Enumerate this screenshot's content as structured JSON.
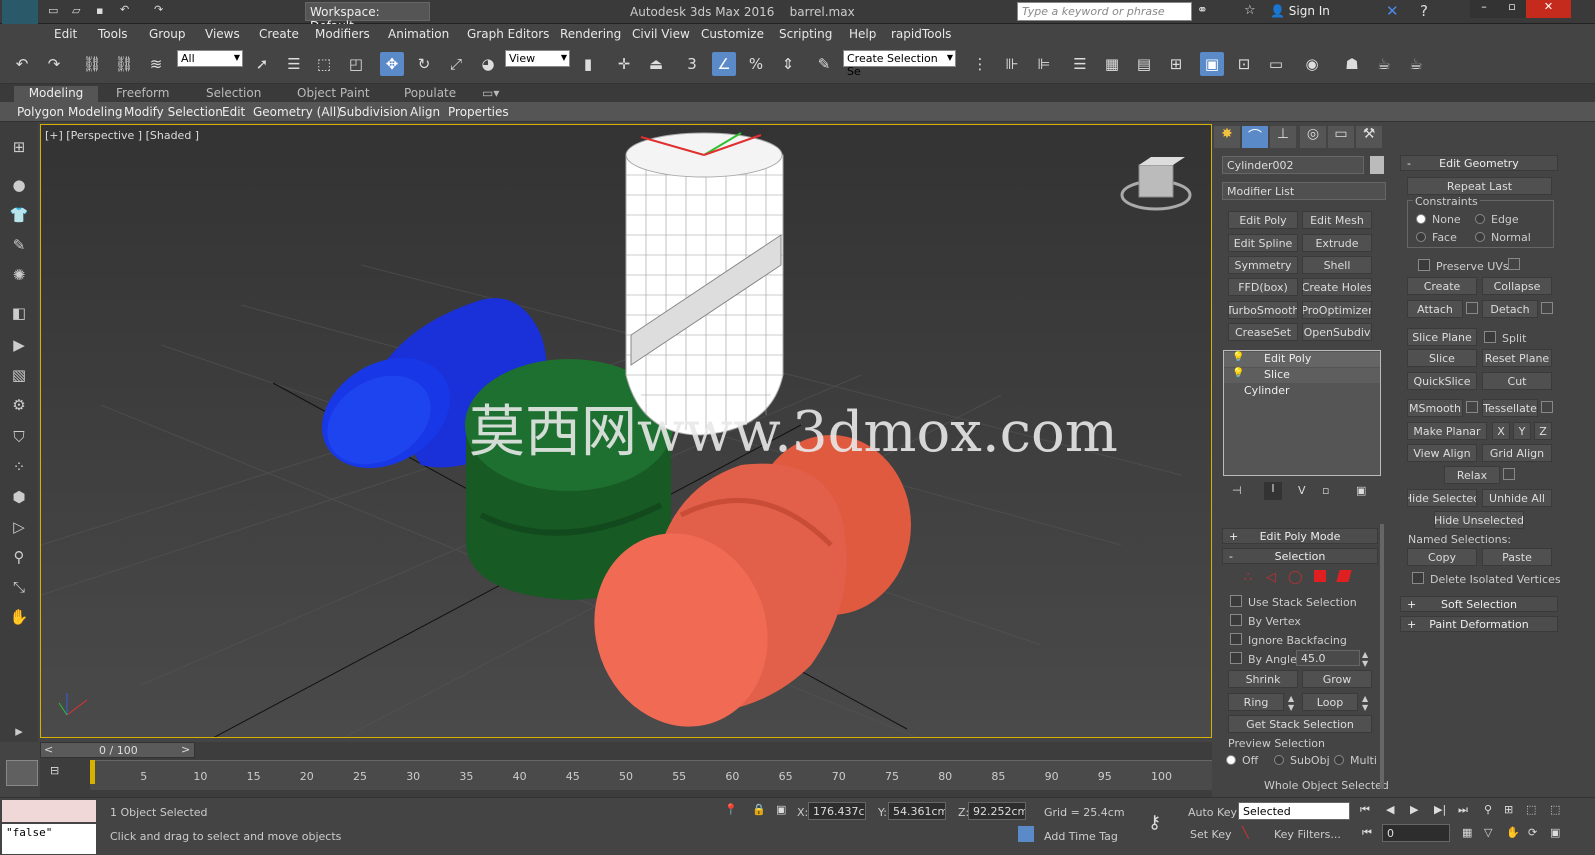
{
  "titlebar": {
    "app_icon": "MAX",
    "workspace": "Workspace: Default",
    "title": "Autodesk 3ds Max 2016",
    "filename": "barrel.max",
    "search_placeholder": "Type a keyword or phrase",
    "sign_in": "Sign In"
  },
  "menubar": [
    "Edit",
    "Tools",
    "Group",
    "Views",
    "Create",
    "Modifiers",
    "Animation",
    "Graph Editors",
    "Rendering",
    "Civil View",
    "Customize",
    "Scripting",
    "Help",
    "rapidTools"
  ],
  "toolbar": {
    "filter": "All",
    "coord_system": "View",
    "selection_set": "Create Selection Se"
  },
  "ribbon_tabs": [
    "Modeling",
    "Freeform",
    "Selection",
    "Object Paint",
    "Populate"
  ],
  "ribbon_sub": [
    "Polygon Modeling",
    "Modify Selection",
    "Edit",
    "Geometry (All)",
    "Subdivision",
    "Align",
    "Properties"
  ],
  "viewport": {
    "label": "[+] [Perspective ] [Shaded ]",
    "watermark": "莫西网www.3dmox.com",
    "colors": {
      "blue": "#1a3de0",
      "green": "#1e6a2c",
      "salmon": "#e86048",
      "wire": "#e0e0e0"
    }
  },
  "command_panel": {
    "object_name": "Cylinder002",
    "modifier_list": "Modifier List",
    "modifier_buttons": [
      "Edit Poly",
      "Edit Mesh",
      "Edit Spline",
      "Extrude",
      "Symmetry",
      "Shell",
      "FFD(box)",
      "Create Holes",
      "TurboSmooth",
      "ProOptimizer",
      "CreaseSet",
      "OpenSubdiv"
    ],
    "stack": [
      "Edit Poly",
      "Slice",
      "Cylinder"
    ],
    "edit_poly_mode": "Edit Poly Mode",
    "selection": "Selection",
    "use_stack_selection": "Use Stack Selection",
    "by_vertex": "By Vertex",
    "ignore_backfacing": "Ignore Backfacing",
    "by_angle": "By Angle:",
    "angle_value": "45.0",
    "shrink": "Shrink",
    "grow": "Grow",
    "ring": "Ring",
    "loop": "Loop",
    "get_stack_selection": "Get Stack Selection",
    "preview_selection": "Preview Selection",
    "preview_off": "Off",
    "preview_subobj": "SubObj",
    "preview_multi": "Multi",
    "whole_object": "Whole Object Selected"
  },
  "edit_geometry": {
    "header": "Edit Geometry",
    "repeat_last": "Repeat Last",
    "constraints": "Constraints",
    "none": "None",
    "edge": "Edge",
    "face": "Face",
    "normal": "Normal",
    "preserve_uvs": "Preserve UVs",
    "create": "Create",
    "collapse": "Collapse",
    "attach": "Attach",
    "detach": "Detach",
    "slice_plane": "Slice Plane",
    "split": "Split",
    "slice": "Slice",
    "reset_plane": "Reset Plane",
    "quickslice": "QuickSlice",
    "cut": "Cut",
    "msmooth": "MSmooth",
    "tessellate": "Tessellate",
    "make_planar": "Make Planar",
    "x": "X",
    "y": "Y",
    "z": "Z",
    "view_align": "View Align",
    "grid_align": "Grid Align",
    "relax": "Relax",
    "hide_selected": "Hide Selected",
    "unhide_all": "Unhide All",
    "hide_unselected": "Hide Unselected",
    "named_selections": "Named Selections:",
    "copy": "Copy",
    "paste": "Paste",
    "delete_isolated": "Delete Isolated Vertices",
    "soft_selection": "Soft Selection",
    "paint_deformation": "Paint Deformation"
  },
  "timeline": {
    "frame": "0 / 100",
    "ticks": [
      "5",
      "10",
      "15",
      "20",
      "25",
      "30",
      "35",
      "40",
      "45",
      "50",
      "55",
      "60",
      "65",
      "70",
      "75",
      "80",
      "85",
      "90",
      "95",
      "100"
    ]
  },
  "status": {
    "maxscript": "\"false\"",
    "selected": "1 Object Selected",
    "prompt": "Click and drag to select and move objects",
    "x_label": "X:",
    "x": "176.437cm",
    "y_label": "Y:",
    "y": "54.361cm",
    "z_label": "Z:",
    "z": "92.252cm",
    "grid": "Grid = 25.4cm",
    "add_time_tag": "Add Time Tag",
    "auto_key": "Auto Key",
    "set_key": "Set Key",
    "key_mode": "Selected",
    "key_filters": "Key Filters...",
    "frame_value": "0"
  }
}
